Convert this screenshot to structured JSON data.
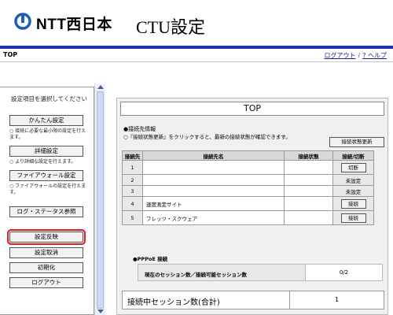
{
  "header": {
    "logo_text": "NTT西日本",
    "page_title": "CTU設定"
  },
  "topbar": {
    "title": "TOP",
    "logout_link": "ログアウト",
    "separator": "/",
    "help_link": "? ヘルプ"
  },
  "sidebar": {
    "title": "設定項目を選択してください",
    "easy_setup": "かんたん設定",
    "easy_note": "○ 接続に必要な最小限の設定を行えます。",
    "detail_setup": "詳細設定",
    "detail_note": "○ より詳細な設定を行えます。",
    "firewall_setup": "ファイアウォール設定",
    "firewall_note": "○ ファイアウォールの設定を行えます。",
    "log_status": "ログ・ステータス参照",
    "apply_settings": "設定反映",
    "cancel_settings": "設定取消",
    "initialize": "初期化",
    "logout": "ログアウト"
  },
  "main": {
    "banner": "TOP",
    "connection_info_title": "●接続先情報",
    "connection_note": "○『接続状態更新』をクリックすると、最新の接続状態が確認できます。",
    "update_status_button": "接続状態更新",
    "table": {
      "headers": [
        "接続先",
        "接続先名",
        "接続状態",
        "接続/切断"
      ],
      "rows": [
        {
          "num": "1",
          "name": "",
          "state": "",
          "action": "切断",
          "action_is_button": true
        },
        {
          "num": "2",
          "name": "",
          "state": "",
          "action": "未設定",
          "action_is_button": false
        },
        {
          "num": "3",
          "name": "",
          "state": "",
          "action": "未設定",
          "action_is_button": false
        },
        {
          "num": "4",
          "name": "速度測定サイト",
          "state": "",
          "action": "接続",
          "action_is_button": true
        },
        {
          "num": "5",
          "name": "フレッツ・スクウェア",
          "state": "",
          "action": "接続",
          "action_is_button": true
        }
      ]
    },
    "pppoe_title": "●PPPoE 接続",
    "pppoe_label": "現在のセッション数／接続可能セッション数",
    "pppoe_value": "0/2",
    "total_label": "接続中セッション数(合計)",
    "total_value": "1"
  },
  "colors": {
    "header_line": "#1e35a3",
    "highlight_outline": "#e21b1b",
    "link": "#1a1aa8",
    "logo_blue": "#1a5fb4"
  },
  "icons": {
    "logo": "ntt-logo-icon",
    "scroll_up": "scroll-up-arrow-icon",
    "scroll_down": "scroll-down-arrow-icon"
  }
}
